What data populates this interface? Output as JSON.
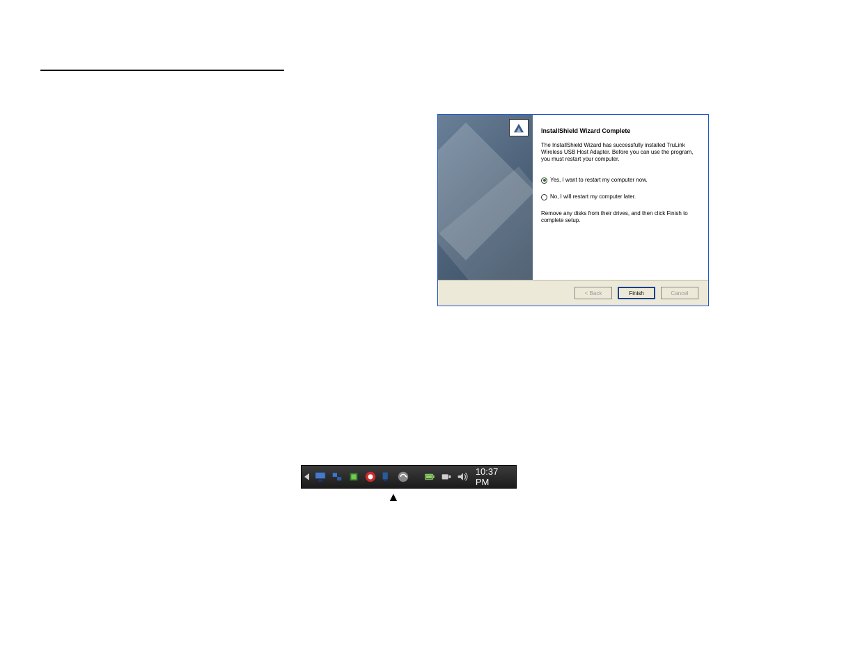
{
  "dialog": {
    "title": "InstallShield Wizard Complete",
    "desc": "The InstallShield Wizard has successfully installed TruLink Wireless USB Host Adapter.  Before you can use the program, you must restart your computer.",
    "option_yes": "Yes, I want to restart my computer now.",
    "option_no": "No, I will restart my computer later.",
    "instruction": "Remove any disks from their drives, and then click Finish to complete setup.",
    "back_label": "< Back",
    "finish_label": "Finish",
    "cancel_label": "Cancel"
  },
  "taskbar": {
    "time": "10:37 PM"
  }
}
